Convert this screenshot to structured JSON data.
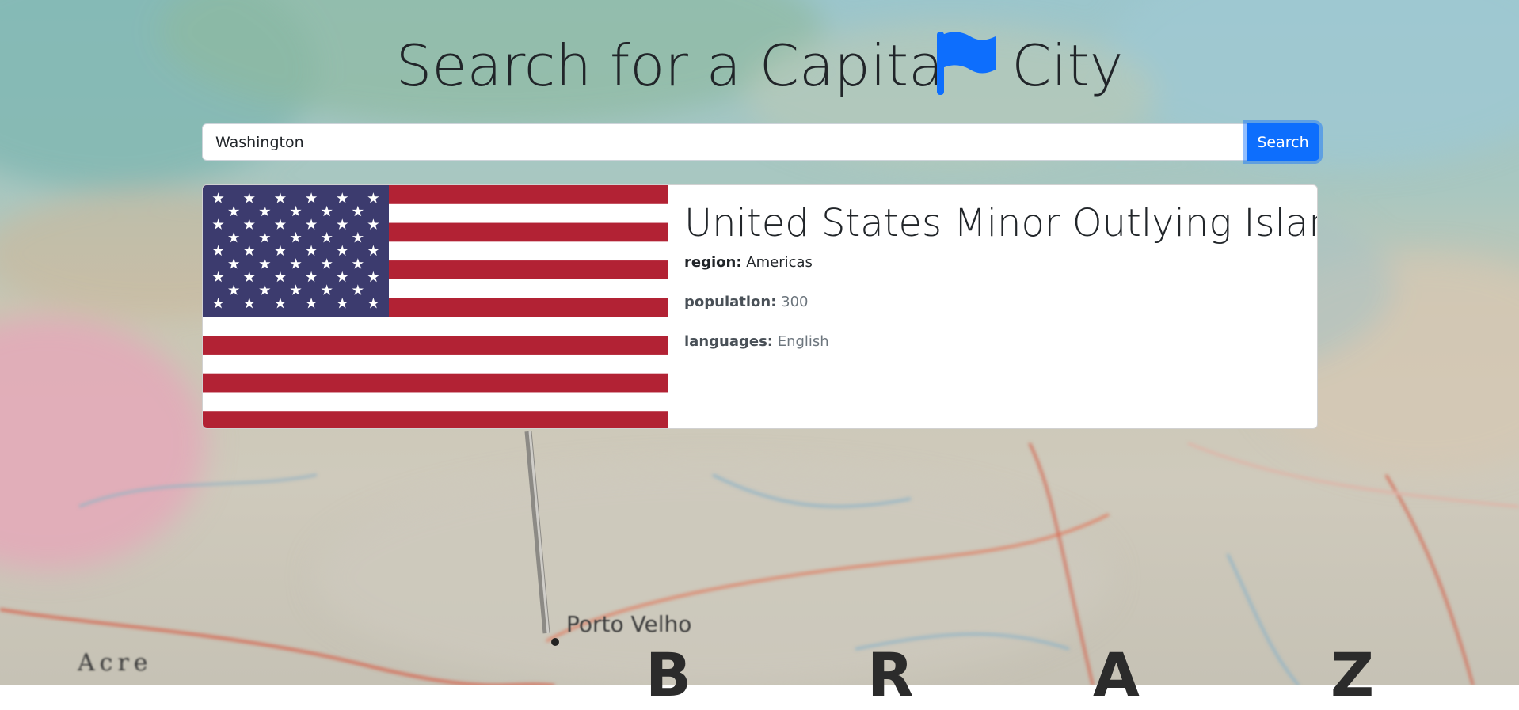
{
  "header": {
    "title_before": "Search for a Capita",
    "title_after": "City",
    "title_icon": "flag-icon",
    "accent_color": "#0d6efd"
  },
  "search": {
    "value": "Washington",
    "button_label": "Search"
  },
  "result": {
    "country_name": "United States Minor Outlying Islands",
    "flag": "us-flag",
    "region_label": "region:",
    "region_value": "Americas",
    "population_label": "population:",
    "population_value": "300",
    "languages_label": "languages:",
    "languages_value": "English"
  },
  "background": {
    "map_labels": [
      "Acre",
      "Porto Velho",
      "B",
      "R",
      "A",
      "Z"
    ]
  }
}
